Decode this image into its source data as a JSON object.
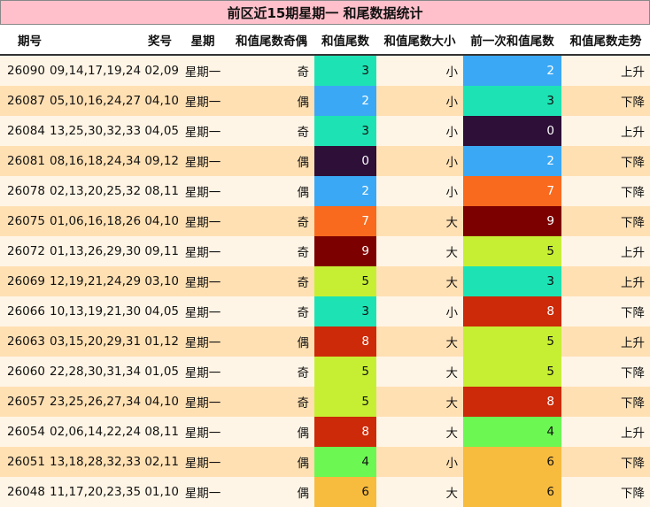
{
  "title": "前区近15期星期一 和尾数据统计",
  "headers": [
    "期号",
    "奖号",
    "星期",
    "和值尾数奇偶",
    "和值尾数",
    "和值尾数大小",
    "前一次和值尾数",
    "和值尾数走势"
  ],
  "digit_colors": {
    "0": {
      "bg": "#2d0f38",
      "fg": "#ffffff"
    },
    "2": {
      "bg": "#3aa8f5",
      "fg": "#ffffff"
    },
    "3": {
      "bg": "#1de3b4",
      "fg": "#111111"
    },
    "4": {
      "bg": "#6cf753",
      "fg": "#111111"
    },
    "5": {
      "bg": "#c6ef34",
      "fg": "#111111"
    },
    "6": {
      "bg": "#f7bb3e",
      "fg": "#111111"
    },
    "7": {
      "bg": "#f96a1e",
      "fg": "#ffffff"
    },
    "8": {
      "bg": "#cc2a08",
      "fg": "#ffffff"
    },
    "9": {
      "bg": "#7d0000",
      "fg": "#ffffff"
    }
  },
  "rows": [
    {
      "issue": "26090",
      "nums": "09,14,17,19,24 02,09",
      "week": "星期一",
      "parity": "奇",
      "tail": "3",
      "size": "小",
      "prev": "2",
      "trend": "上升"
    },
    {
      "issue": "26087",
      "nums": "05,10,16,24,27 04,10",
      "week": "星期一",
      "parity": "偶",
      "tail": "2",
      "size": "小",
      "prev": "3",
      "trend": "下降"
    },
    {
      "issue": "26084",
      "nums": "13,25,30,32,33 04,05",
      "week": "星期一",
      "parity": "奇",
      "tail": "3",
      "size": "小",
      "prev": "0",
      "trend": "上升"
    },
    {
      "issue": "26081",
      "nums": "08,16,18,24,34 09,12",
      "week": "星期一",
      "parity": "偶",
      "tail": "0",
      "size": "小",
      "prev": "2",
      "trend": "下降"
    },
    {
      "issue": "26078",
      "nums": "02,13,20,25,32 08,11",
      "week": "星期一",
      "parity": "偶",
      "tail": "2",
      "size": "小",
      "prev": "7",
      "trend": "下降"
    },
    {
      "issue": "26075",
      "nums": "01,06,16,18,26 04,10",
      "week": "星期一",
      "parity": "奇",
      "tail": "7",
      "size": "大",
      "prev": "9",
      "trend": "下降"
    },
    {
      "issue": "26072",
      "nums": "01,13,26,29,30 09,11",
      "week": "星期一",
      "parity": "奇",
      "tail": "9",
      "size": "大",
      "prev": "5",
      "trend": "上升"
    },
    {
      "issue": "26069",
      "nums": "12,19,21,24,29 03,10",
      "week": "星期一",
      "parity": "奇",
      "tail": "5",
      "size": "大",
      "prev": "3",
      "trend": "上升"
    },
    {
      "issue": "26066",
      "nums": "10,13,19,21,30 04,05",
      "week": "星期一",
      "parity": "奇",
      "tail": "3",
      "size": "小",
      "prev": "8",
      "trend": "下降"
    },
    {
      "issue": "26063",
      "nums": "03,15,20,29,31 01,12",
      "week": "星期一",
      "parity": "偶",
      "tail": "8",
      "size": "大",
      "prev": "5",
      "trend": "上升"
    },
    {
      "issue": "26060",
      "nums": "22,28,30,31,34 01,05",
      "week": "星期一",
      "parity": "奇",
      "tail": "5",
      "size": "大",
      "prev": "5",
      "trend": "下降"
    },
    {
      "issue": "26057",
      "nums": "23,25,26,27,34 04,10",
      "week": "星期一",
      "parity": "奇",
      "tail": "5",
      "size": "大",
      "prev": "8",
      "trend": "下降"
    },
    {
      "issue": "26054",
      "nums": "02,06,14,22,24 08,11",
      "week": "星期一",
      "parity": "偶",
      "tail": "8",
      "size": "大",
      "prev": "4",
      "trend": "上升"
    },
    {
      "issue": "26051",
      "nums": "13,18,28,32,33 02,11",
      "week": "星期一",
      "parity": "偶",
      "tail": "4",
      "size": "小",
      "prev": "6",
      "trend": "下降"
    },
    {
      "issue": "26048",
      "nums": "11,17,20,23,35 01,10",
      "week": "星期一",
      "parity": "偶",
      "tail": "6",
      "size": "大",
      "prev": "6",
      "trend": "下降"
    }
  ]
}
